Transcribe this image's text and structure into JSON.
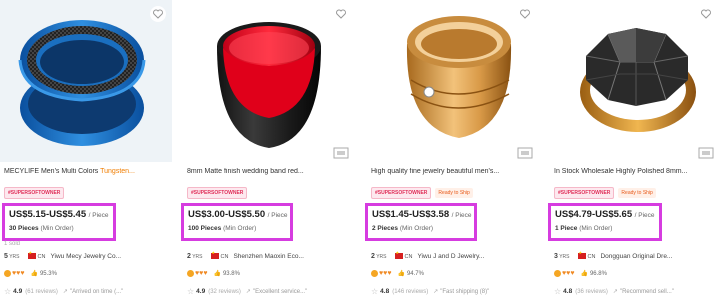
{
  "products": [
    {
      "title": "MECYLIFE Men's Multi Colors ",
      "title_highlight": "Tungsten...",
      "badges": [
        "#SUPERSOFTOWNER"
      ],
      "price": "US$5.15-US$5.45",
      "unit": "/ Piece",
      "moq": "30 Pieces",
      "moq_suffix": "(Min Order)",
      "extra": "1 sold",
      "years": "5",
      "yrs_label": "YRS",
      "country": "CN",
      "supplier": "Yiwu Mecy Jewelry Co...",
      "response": "95.3%",
      "score": "4.9",
      "reviews": "(61 reviews)",
      "quote": "\"Arrived on time (...\"",
      "image": {
        "kind": "blue-ring",
        "bg": "#eef3f7"
      }
    },
    {
      "title": "8mm Matte finish wedding band red...",
      "title_highlight": "",
      "badges": [
        "#SUPERSOFTOWNER"
      ],
      "price": "US$3.00-US$5.50",
      "unit": "/ Piece",
      "moq": "100 Pieces",
      "moq_suffix": "(Min Order)",
      "extra": "",
      "years": "2",
      "yrs_label": "YRS",
      "country": "CN",
      "supplier": "Shenzhen Maoxin Eco...",
      "response": "93.8%",
      "score": "4.9",
      "reviews": "(32 reviews)",
      "quote": "\"Excellent service...\"",
      "image": {
        "kind": "red-black-ring",
        "bg": "#ffffff"
      }
    },
    {
      "title": "High quality fine jewelry beautiful men's...",
      "title_highlight": "",
      "badges": [
        "#SUPERSOFTOWNER",
        "Ready to Ship"
      ],
      "price": "US$1.45-US$3.58",
      "unit": "/ Piece",
      "moq": "2 Pieces",
      "moq_suffix": "(Min Order)",
      "extra": "",
      "years": "2",
      "yrs_label": "YRS",
      "country": "CN",
      "supplier": "Yiwu J and D Jewelry...",
      "response": "94.7%",
      "score": "4.8",
      "reviews": "(146 reviews)",
      "quote": "\"Fast shipping (8)\"",
      "image": {
        "kind": "gold-ring",
        "bg": "#ffffff"
      }
    },
    {
      "title": "In Stock Wholesale Highly Polished 8mm...",
      "title_highlight": "",
      "badges": [
        "#SUPERSOFTOWNER",
        "Ready to Ship"
      ],
      "price": "US$4.79-US$5.65",
      "unit": "/ Piece",
      "moq": "1 Piece",
      "moq_suffix": "(Min Order)",
      "extra": "",
      "years": "3",
      "yrs_label": "YRS",
      "country": "CN",
      "supplier": "Dongguan Original Dre...",
      "response": "96.8%",
      "score": "4.8",
      "reviews": "(36 reviews)",
      "quote": "\"Recommend sell...\"",
      "image": {
        "kind": "faceted-ring",
        "bg": "#ffffff"
      }
    }
  ],
  "colors": {
    "highlight_border": "#d63ce0",
    "title_highlight": "#f07d00",
    "badge_super": "#e0305a",
    "badge_ready": "#e85a1a"
  }
}
